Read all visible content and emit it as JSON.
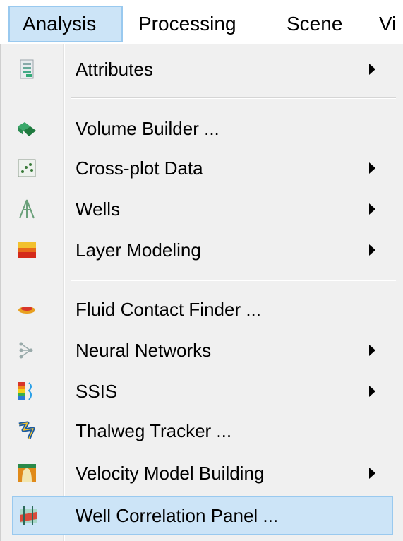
{
  "menubar": {
    "items": [
      {
        "label": "Analysis",
        "active": true
      },
      {
        "label": "Processing"
      },
      {
        "label": "Scene"
      },
      {
        "label": "Vi"
      }
    ]
  },
  "menu": {
    "items": [
      {
        "label": "Attributes",
        "icon": "attributes-icon",
        "submenu": true
      },
      {
        "label": "Volume Builder ...",
        "icon": "volume-builder-icon",
        "submenu": false
      },
      {
        "label": "Cross-plot Data",
        "icon": "cross-plot-icon",
        "submenu": true
      },
      {
        "label": "Wells",
        "icon": "wells-icon",
        "submenu": true
      },
      {
        "label": "Layer Modeling",
        "icon": "layer-modeling-icon",
        "submenu": true
      },
      {
        "label": "Fluid Contact Finder ...",
        "icon": "fluid-contact-icon",
        "submenu": false
      },
      {
        "label": "Neural Networks",
        "icon": "neural-networks-icon",
        "submenu": true
      },
      {
        "label": "SSIS",
        "icon": "ssis-icon",
        "submenu": true
      },
      {
        "label": "Thalweg Tracker ...",
        "icon": "thalweg-tracker-icon",
        "submenu": false
      },
      {
        "label": "Velocity Model Building",
        "icon": "velocity-model-icon",
        "submenu": true
      },
      {
        "label": "Well Correlation Panel ...",
        "icon": "well-correlation-icon",
        "submenu": false,
        "highlighted": true
      }
    ]
  },
  "colors": {
    "highlight_bg": "#cce4f7",
    "highlight_border": "#99c9ef",
    "menu_bg": "#f0f0f0"
  }
}
